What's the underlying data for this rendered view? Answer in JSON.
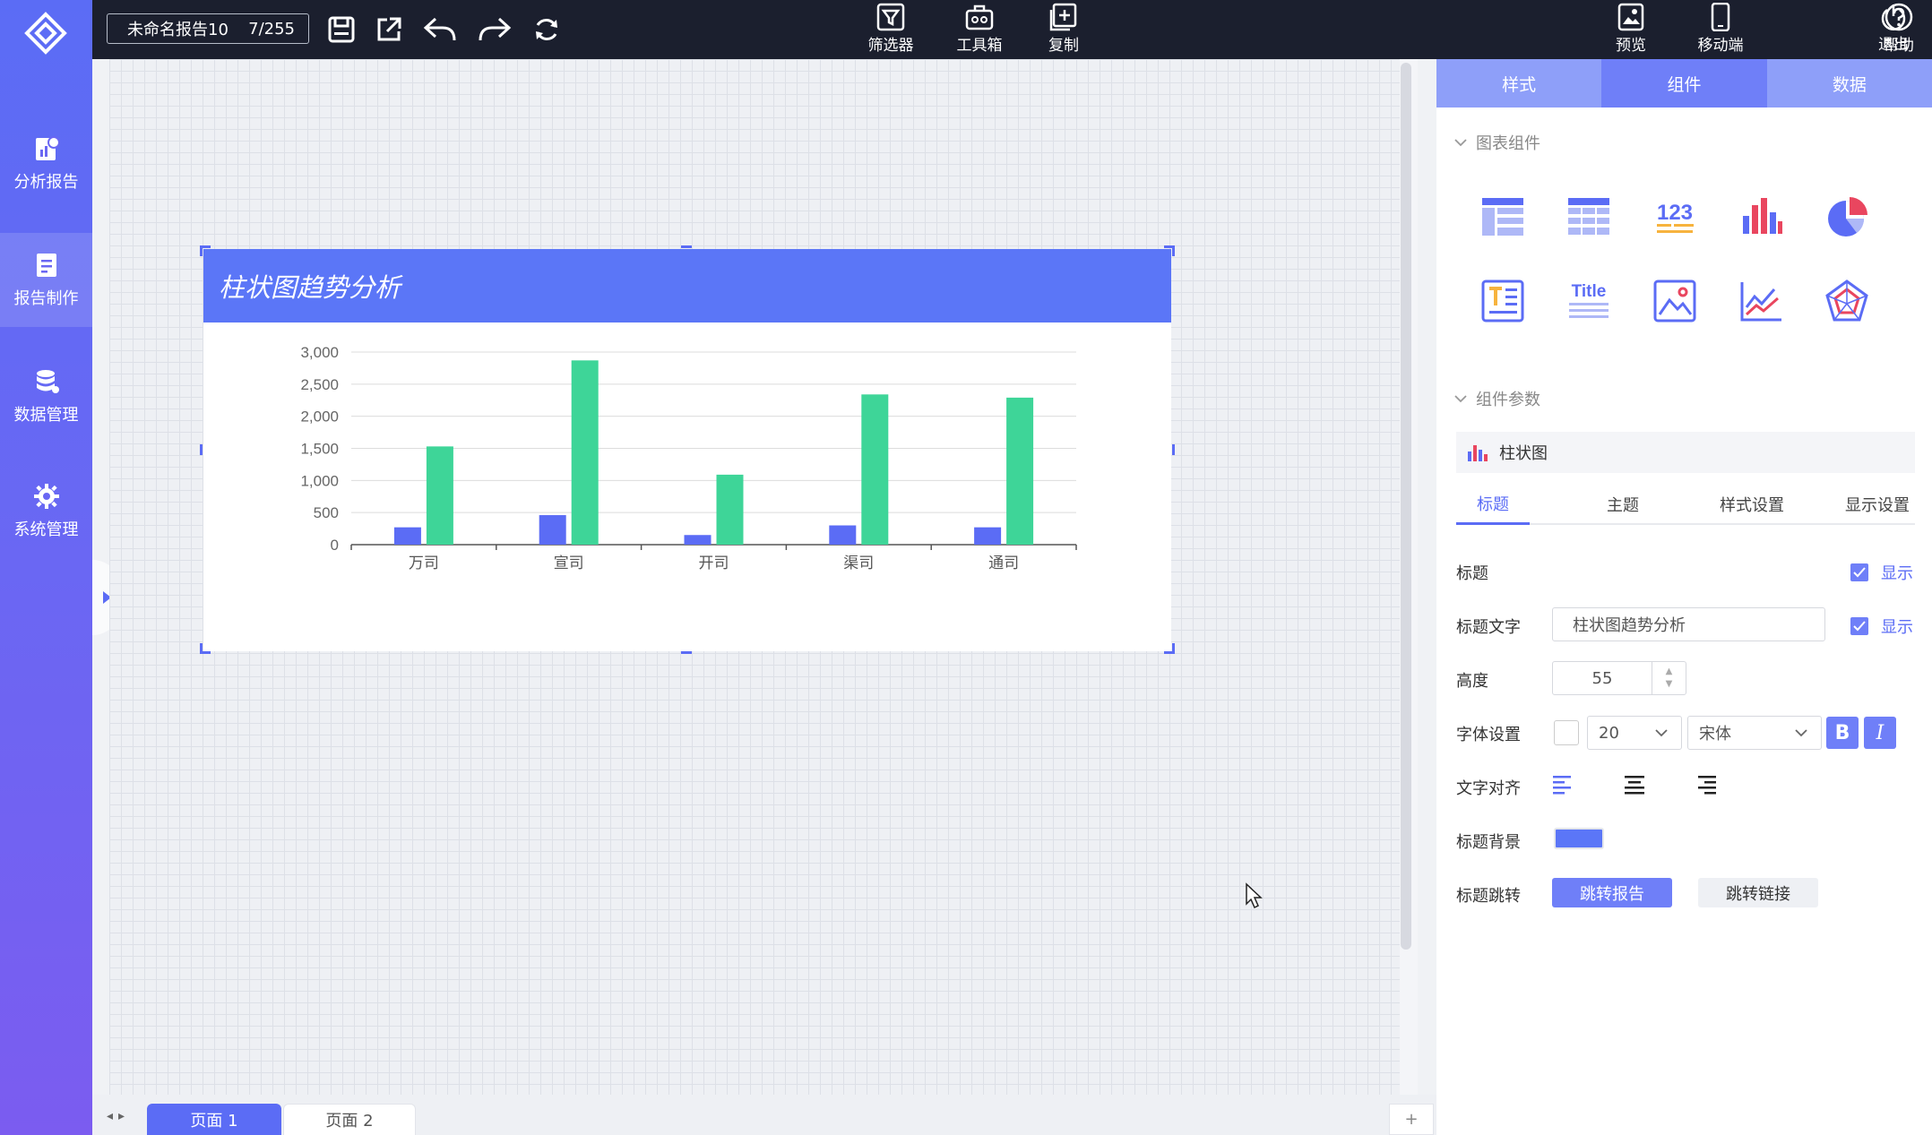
{
  "sidebar": {
    "items": [
      {
        "label": "分析报告",
        "icon": "analysis-report-icon"
      },
      {
        "label": "报告制作",
        "icon": "report-edit-icon"
      },
      {
        "label": "数据管理",
        "icon": "database-icon"
      },
      {
        "label": "系统管理",
        "icon": "gear-icon"
      }
    ],
    "active": "报告制作"
  },
  "topbar": {
    "report_name": "未命名报告10",
    "page_count": "7/255",
    "buttons": {
      "filter": "筛选器",
      "toolbox": "工具箱",
      "copy": "复制",
      "preview": "预览",
      "mobile": "移动端",
      "help": "帮助",
      "logout": "退出"
    }
  },
  "canvas": {
    "chart_title": "柱状图趋势分析"
  },
  "chart_data": {
    "type": "bar",
    "categories": [
      "万司",
      "宣司",
      "开司",
      "渠司",
      "通司"
    ],
    "series": [
      {
        "values": [
          270,
          460,
          150,
          300,
          270
        ],
        "color": "#5b6cf5"
      },
      {
        "values": [
          1530,
          2870,
          1090,
          2340,
          2290
        ],
        "color": "#3ed598"
      }
    ],
    "y_ticks": [
      "0",
      "500",
      "1,000",
      "1,500",
      "2,000",
      "2,500",
      "3,000"
    ],
    "ylim": [
      0,
      3000
    ],
    "grid": true,
    "title": "柱状图趋势分析"
  },
  "pages": {
    "tabs": [
      "页面 1",
      "页面 2"
    ],
    "active": "页面 1",
    "add_label": "+"
  },
  "panel": {
    "tabs": [
      "样式",
      "组件",
      "数据"
    ],
    "active_tab": "组件",
    "section_components": "图表组件",
    "section_params": "组件参数",
    "component_icons": [
      "table-icon",
      "cross-table-icon",
      "number-card-icon",
      "bar-chart-icon",
      "pie-chart-icon",
      "text-box-icon",
      "title-icon",
      "image-icon",
      "line-chart-icon",
      "radar-chart-icon"
    ],
    "title_icon_text": "Title",
    "number_icon_text": "123",
    "component_name": "柱状图",
    "sub_tabs": [
      "标题",
      "主题",
      "样式设置",
      "显示设置"
    ],
    "active_sub_tab": "标题",
    "rows": {
      "title_label": "标题",
      "title_show": "显示",
      "title_text_label": "标题文字",
      "title_text_value": "柱状图趋势分析",
      "title_text_show": "显示",
      "height_label": "高度",
      "height_value": "55",
      "font_label": "字体设置",
      "font_size": "20",
      "font_family": "宋体",
      "bold": "B",
      "italic": "I",
      "align_label": "文字对齐",
      "bg_label": "标题背景",
      "bg_color": "#5b76f7",
      "jump_label": "标题跳转",
      "jump_report": "跳转报告",
      "jump_link": "跳转链接"
    }
  }
}
